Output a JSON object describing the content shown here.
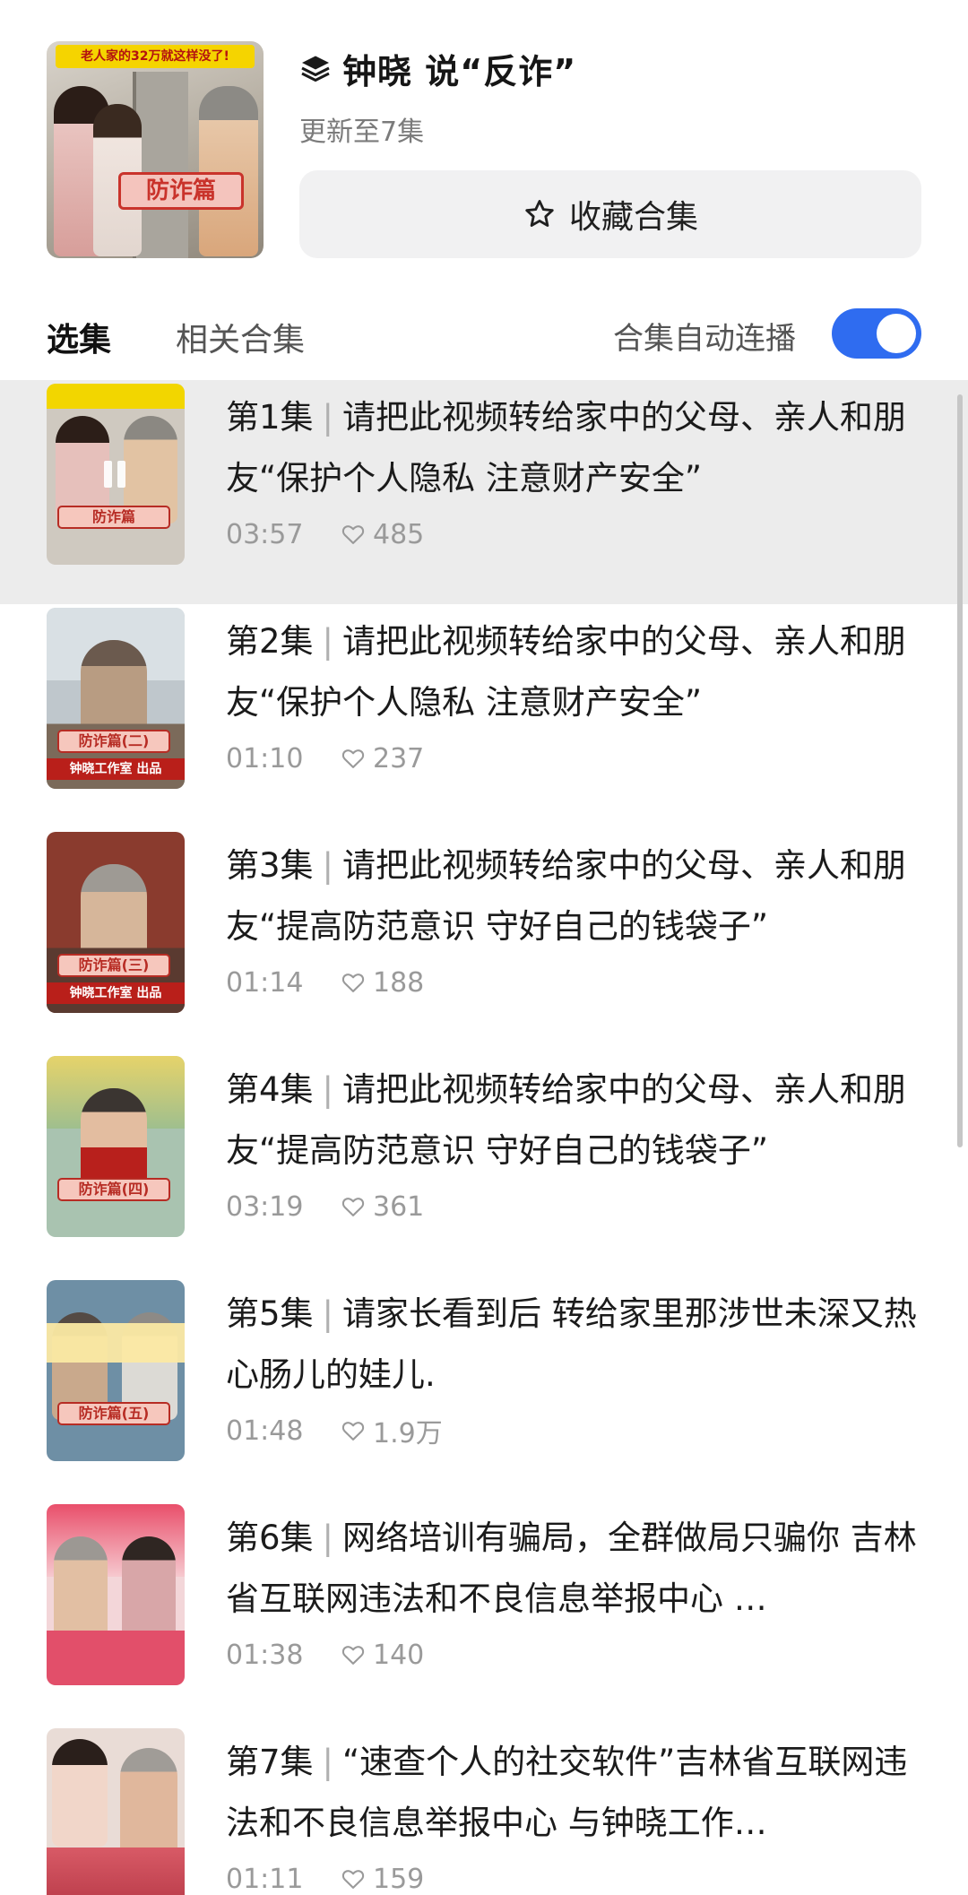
{
  "header": {
    "cover_banner": "老人家的32万就这样没了!",
    "cover_tag": "防诈篇",
    "title": "钟晓 说“反诈”",
    "subtitle": "更新至7集",
    "collect_label": "收藏合集"
  },
  "tabs": {
    "selected": "选集",
    "related": "相关合集",
    "autoplay_label": "合集自动连播",
    "autoplay_on": true
  },
  "colors": {
    "accent": "#2f6cf0",
    "highlight_row": "#ececec"
  },
  "episodes": [
    {
      "num": "第1集",
      "sep": "|",
      "title": "请把此视频转给家中的父母、亲人和朋友“保护个人隐私 注意财产安全”",
      "duration": "03:57",
      "likes": "485",
      "playing": true,
      "thumb_tag": "防诈篇",
      "thumb_strip": ""
    },
    {
      "num": "第2集",
      "sep": "|",
      "title": "请把此视频转给家中的父母、亲人和朋友“保护个人隐私 注意财产安全”",
      "duration": "01:10",
      "likes": "237",
      "playing": false,
      "thumb_tag": "防诈篇(二)",
      "thumb_strip": "钟晓工作室 出品"
    },
    {
      "num": "第3集",
      "sep": "|",
      "title": "请把此视频转给家中的父母、亲人和朋友“提高防范意识 守好自己的钱袋子”",
      "duration": "01:14",
      "likes": "188",
      "playing": false,
      "thumb_tag": "防诈篇(三)",
      "thumb_strip": "钟晓工作室 出品"
    },
    {
      "num": "第4集",
      "sep": "|",
      "title": "请把此视频转给家中的父母、亲人和朋友“提高防范意识 守好自己的钱袋子”",
      "duration": "03:19",
      "likes": "361",
      "playing": false,
      "thumb_tag": "防诈篇(四)",
      "thumb_strip": ""
    },
    {
      "num": "第5集",
      "sep": "|",
      "title": "请家长看到后 转给家里那涉世未深又热心肠儿的娃儿.",
      "duration": "01:48",
      "likes": "1.9万",
      "playing": false,
      "thumb_tag": "防诈篇(五)",
      "thumb_strip": ""
    },
    {
      "num": "第6集",
      "sep": "|",
      "title": "网络培训有骗局，全群做局只骗你 吉林省互联网违法和不良信息举报中心 …",
      "duration": "01:38",
      "likes": "140",
      "playing": false,
      "thumb_tag": "",
      "thumb_strip": ""
    },
    {
      "num": "第7集",
      "sep": "|",
      "title": "“速查个人的社交软件”吉林省互联网违法和不良信息举报中心 与钟晓工作…",
      "duration": "01:11",
      "likes": "159",
      "playing": false,
      "thumb_tag": "",
      "thumb_strip": ""
    }
  ]
}
